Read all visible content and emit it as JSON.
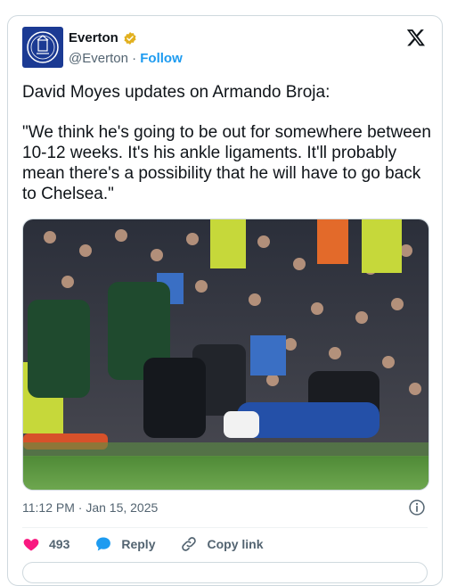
{
  "author": {
    "name": "Everton",
    "handle": "@Everton",
    "separator": "·",
    "follow_label": "Follow",
    "verified_badge_color": "#e2b01f",
    "avatar_icon": "everton-crest-icon",
    "avatar_color": "#1b3a93"
  },
  "tweet": {
    "paragraph1": "David Moyes updates on Armando Broja:",
    "paragraph2": "\"We think he's going to be out for somewhere between 10-12 weeks. It's his ankle ligaments. It'll probably mean there's a possibility that he will have to go back to Chelsea.\"",
    "photo_icon": "match-injury-photo",
    "timestamp": "11:12 PM · Jan 15, 2025"
  },
  "actions": {
    "likes_count": "493",
    "reply_label": "Reply",
    "copy_link_label": "Copy link",
    "like_color": "#f91880",
    "reply_color": "#1d9bf0"
  },
  "icons": {
    "x_logo": "x-logo-icon",
    "info": "info-icon"
  }
}
